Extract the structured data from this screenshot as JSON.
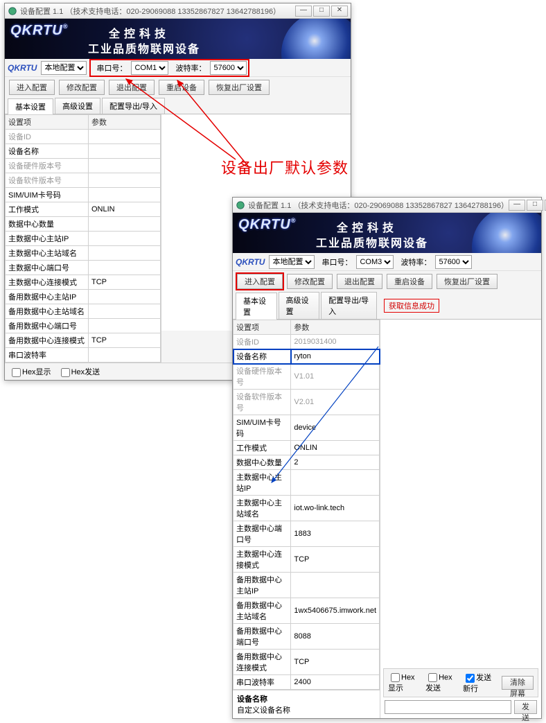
{
  "annotation": "设备出厂默认参数",
  "window1": {
    "title": "设备配置 1.1 （技术支持电话：020-29069088  13352867827 13642788196）",
    "banner": {
      "logo": "QKRTU",
      "reg": "®",
      "line1": "全控科技",
      "line2": "工业品质物联网设备"
    },
    "toolbar": {
      "local": "本地配置",
      "port_label": "串口号：",
      "port": "COM1",
      "baud_label": "波特率：",
      "baud": "57600"
    },
    "buttons": {
      "enter": "进入配置",
      "modify": "修改配置",
      "exit": "退出配置",
      "reboot": "重启设备",
      "factory": "恢复出厂设置"
    },
    "tabs": {
      "basic": "基本设置",
      "adv": "高级设置",
      "io": "配置导出/导入"
    },
    "table": {
      "h1": "设置项",
      "h2": "参数",
      "rows": [
        {
          "k": "设备ID",
          "v": "",
          "gray": true
        },
        {
          "k": "设备名称",
          "v": ""
        },
        {
          "k": "设备硬件版本号",
          "v": "",
          "gray": true
        },
        {
          "k": "设备软件版本号",
          "v": "",
          "gray": true
        },
        {
          "k": "SIM/UIM卡号码",
          "v": ""
        },
        {
          "k": "工作模式",
          "v": "ONLIN"
        },
        {
          "k": "数据中心数量",
          "v": ""
        },
        {
          "k": "主数据中心主站IP",
          "v": ""
        },
        {
          "k": "主数据中心主站域名",
          "v": ""
        },
        {
          "k": "主数据中心端口号",
          "v": ""
        },
        {
          "k": "主数据中心连接模式",
          "v": "TCP"
        },
        {
          "k": "备用数据中心主站IP",
          "v": ""
        },
        {
          "k": "备用数据中心主站域名",
          "v": ""
        },
        {
          "k": "备用数据中心端口号",
          "v": ""
        },
        {
          "k": "备用数据中心连接模式",
          "v": "TCP"
        },
        {
          "k": "串口波特率",
          "v": ""
        }
      ]
    },
    "footer": {
      "hex_show": "Hex显示",
      "hex_send": "Hex发送"
    }
  },
  "window2": {
    "title": "设备配置 1.1 （技术支持电话：020-29069088  13352867827 13642788196）",
    "banner": {
      "logo": "QKRTU",
      "reg": "®",
      "line1": "全控科技",
      "line2": "工业品质物联网设备"
    },
    "toolbar": {
      "local": "本地配置",
      "port_label": "串口号：",
      "port": "COM3",
      "baud_label": "波特率：",
      "baud": "57600"
    },
    "buttons": {
      "enter": "进入配置",
      "modify": "修改配置",
      "exit": "退出配置",
      "reboot": "重启设备",
      "factory": "恢复出厂设置"
    },
    "tabs": {
      "basic": "基本设置",
      "adv": "高级设置",
      "io": "配置导出/导入"
    },
    "status": "获取信息成功",
    "table": {
      "h1": "设置项",
      "h2": "参数",
      "rows": [
        {
          "k": "设备ID",
          "v": "2019031400",
          "gray": true
        },
        {
          "k": "设备名称",
          "v": "ryton",
          "sel": true
        },
        {
          "k": "设备硬件版本号",
          "v": "V1.01",
          "gray": true
        },
        {
          "k": "设备软件版本号",
          "v": "V2.01",
          "gray": true
        },
        {
          "k": "SIM/UIM卡号码",
          "v": "device"
        },
        {
          "k": "工作模式",
          "v": "ONLIN"
        },
        {
          "k": "数据中心数量",
          "v": "2"
        },
        {
          "k": "主数据中心主站IP",
          "v": ""
        },
        {
          "k": "主数据中心主站域名",
          "v": "iot.wo-link.tech"
        },
        {
          "k": "主数据中心端口号",
          "v": "1883"
        },
        {
          "k": "主数据中心连接模式",
          "v": "TCP"
        },
        {
          "k": "备用数据中心主站IP",
          "v": ""
        },
        {
          "k": "备用数据中心主站域名",
          "v": "1wx5406675.imwork.net"
        },
        {
          "k": "备用数据中心端口号",
          "v": "8088"
        },
        {
          "k": "备用数据中心连接模式",
          "v": "TCP"
        },
        {
          "k": "串口波特率",
          "v": "2400"
        }
      ]
    },
    "footer_left": {
      "devname_lbl": "设备名称",
      "custom_lbl": "自定义设备名称"
    },
    "footer": {
      "hex_show": "Hex显示",
      "hex_send": "Hex发送",
      "send_nl": "发送新行",
      "clear": "清除屏幕",
      "send": "发送"
    }
  }
}
